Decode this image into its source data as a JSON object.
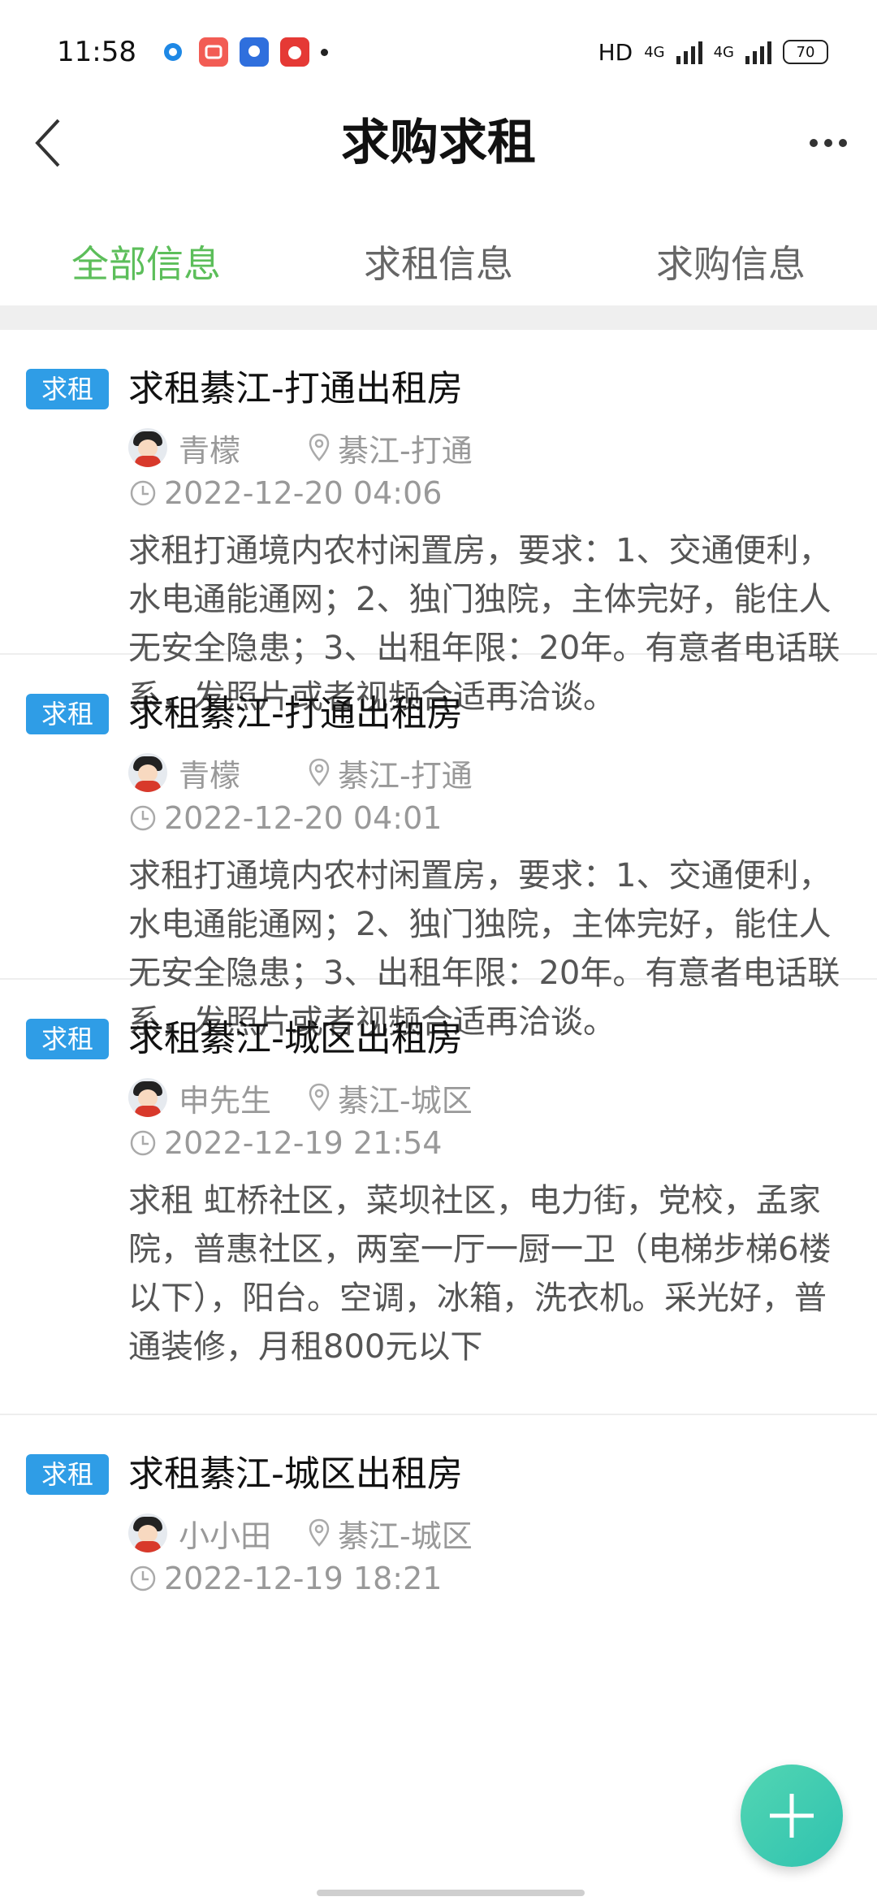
{
  "status_bar": {
    "time": "11:58",
    "network": "HD",
    "signal1": "4G",
    "signal2": "4G",
    "battery": "70"
  },
  "header": {
    "title": "求购求租"
  },
  "tabs": [
    {
      "label": "全部信息",
      "active": true
    },
    {
      "label": "求租信息",
      "active": false
    },
    {
      "label": "求购信息",
      "active": false
    }
  ],
  "listings": [
    {
      "tag": "求租",
      "title": "求租綦江-打通出租房",
      "user": "青檬",
      "location": "綦江-打通",
      "time": "2022-12-20 04:06",
      "description": "求租打通境内农村闲置房，要求：1、交通便利，水电通能通网；2、独门独院，主体完好，能住人无安全隐患；3、出租年限：20年。有意者电话联系，发照片或者视频合适再洽谈。"
    },
    {
      "tag": "求租",
      "title": "求租綦江-打通出租房",
      "user": "青檬",
      "location": "綦江-打通",
      "time": "2022-12-20 04:01",
      "description": "求租打通境内农村闲置房，要求：1、交通便利，水电通能通网；2、独门独院，主体完好，能住人无安全隐患；3、出租年限：20年。有意者电话联系，发照片或者视频合适再洽谈。"
    },
    {
      "tag": "求租",
      "title": "求租綦江-城区出租房",
      "user": "申先生",
      "location": "綦江-城区",
      "time": "2022-12-19 21:54",
      "description": "求租 虹桥社区，菜坝社区，电力街，党校，孟家院，普惠社区，两室一厅一厨一卫（电梯步梯6楼以下），阳台。空调，冰箱，洗衣机。采光好，普通装修，月租800元以下"
    },
    {
      "tag": "求租",
      "title": "求租綦江-城区出租房",
      "user": "小小田",
      "location": "綦江-城区",
      "time": "2022-12-19 18:21",
      "description": ""
    }
  ],
  "colors": {
    "accent": "#5cbe5a",
    "tag": "#2f9de6",
    "fab": "#3cc8b0"
  }
}
